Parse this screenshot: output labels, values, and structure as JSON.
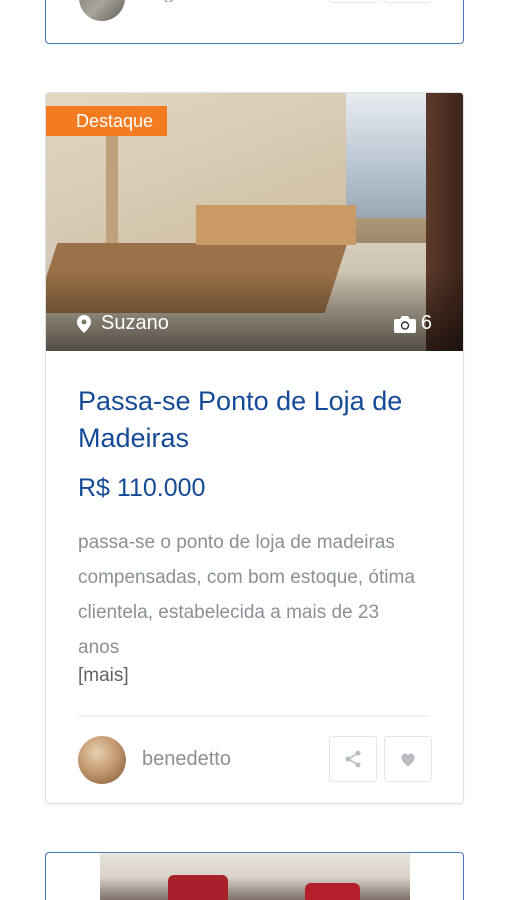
{
  "previous_listing": {
    "username": "tiago"
  },
  "listing": {
    "badge": "Destaque",
    "location": "Suzano",
    "photo_count": "6",
    "title": "Passa-se Ponto de Loja de Madeiras",
    "price": "R$ 110.000",
    "description": "passa-se o ponto de loja de madeiras compensadas, com bom estoque, ótima clientela, estabelecida a mais de 23 anos",
    "more_link": "[mais]",
    "username": "benedetto"
  },
  "colors": {
    "accent_blue": "#154b96",
    "badge_orange": "#f47b20",
    "muted_text": "#8b9096"
  },
  "icons": {
    "location": "map-pin-icon",
    "photos": "camera-icon",
    "share": "share-icon",
    "favorite": "heart-icon"
  }
}
